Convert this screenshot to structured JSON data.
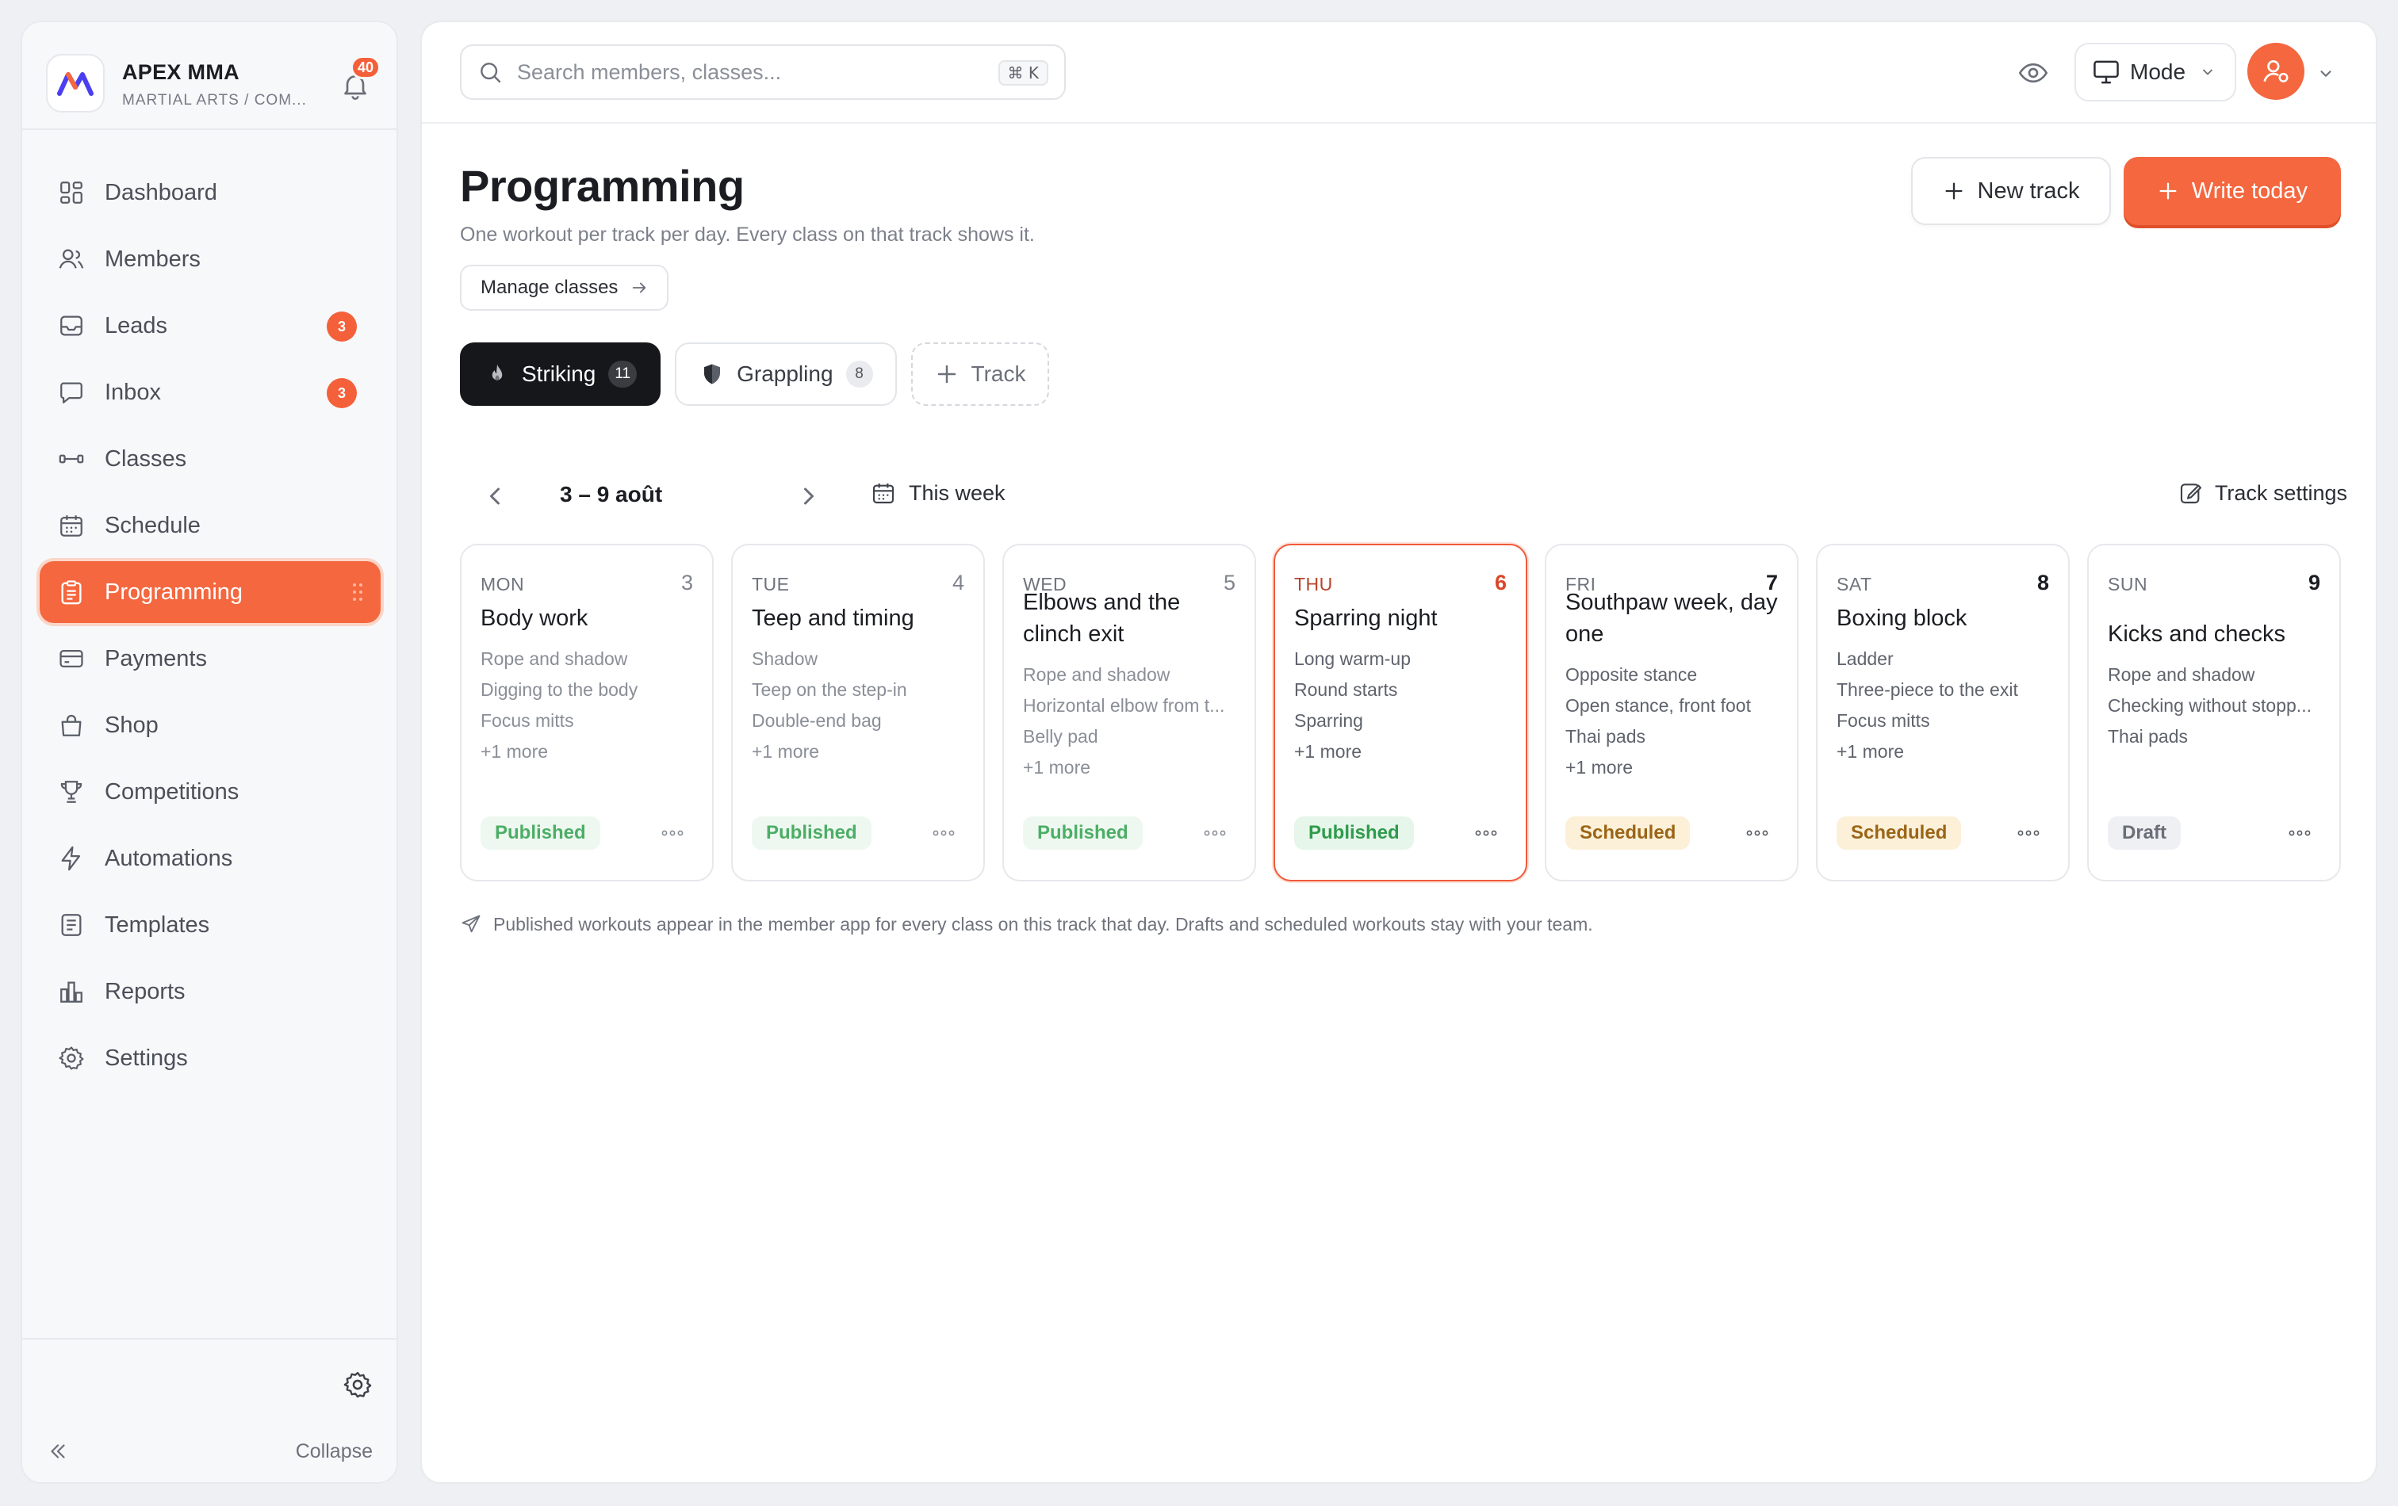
{
  "brand": {
    "name": "APEX MMA",
    "subtitle": "MARTIAL ARTS / COM...",
    "notifications": "40"
  },
  "nav": {
    "items": [
      {
        "label": "Dashboard",
        "icon": "dashboard-icon"
      },
      {
        "label": "Members",
        "icon": "users-icon"
      },
      {
        "label": "Leads",
        "icon": "inbox-tray-icon",
        "badge": "3"
      },
      {
        "label": "Inbox",
        "icon": "chat-bubble-icon",
        "badge": "3"
      },
      {
        "label": "Classes",
        "icon": "dumbbell-icon"
      },
      {
        "label": "Schedule",
        "icon": "calendar-icon"
      },
      {
        "label": "Programming",
        "icon": "clipboard-icon",
        "active": true
      },
      {
        "label": "Payments",
        "icon": "credit-card-icon"
      },
      {
        "label": "Shop",
        "icon": "shopping-bag-icon"
      },
      {
        "label": "Competitions",
        "icon": "trophy-icon"
      },
      {
        "label": "Automations",
        "icon": "lightning-icon"
      },
      {
        "label": "Templates",
        "icon": "document-icon"
      },
      {
        "label": "Reports",
        "icon": "bar-chart-icon"
      },
      {
        "label": "Settings",
        "icon": "gear-icon"
      }
    ],
    "collapse_label": "Collapse"
  },
  "topbar": {
    "search_placeholder": "Search members, classes...",
    "shortcut": "⌘ K",
    "mode_label": "Mode"
  },
  "page": {
    "title": "Programming",
    "subtitle": "One workout per track per day. Every class on that track shows it.",
    "manage_classes": "Manage classes",
    "new_track": "New track",
    "write_today": "Write today"
  },
  "tracks": [
    {
      "label": "Striking",
      "count": "11",
      "icon": "flame-icon",
      "active": true
    },
    {
      "label": "Grappling",
      "count": "8",
      "icon": "shield-icon",
      "active": false
    }
  ],
  "add_track_label": "Track",
  "week": {
    "range": "3 – 9 août",
    "this_week": "This week",
    "track_settings": "Track settings"
  },
  "days": [
    {
      "dow": "MON",
      "num": "3",
      "title": "Body work",
      "lines": [
        "Rope and shadow",
        "Digging to the body",
        "Focus mitts"
      ],
      "more": "+1 more",
      "status": "Published"
    },
    {
      "dow": "TUE",
      "num": "4",
      "title": "Teep and timing",
      "lines": [
        "Shadow",
        "Teep on the step-in",
        "Double-end bag"
      ],
      "more": "+1 more",
      "status": "Published"
    },
    {
      "dow": "WED",
      "num": "5",
      "title": "Elbows and the clinch exit",
      "lines": [
        "Rope and shadow",
        "Horizontal elbow from t...",
        "Belly pad"
      ],
      "more": "+1 more",
      "status": "Published"
    },
    {
      "dow": "THU",
      "num": "6",
      "title": "Sparring night",
      "lines": [
        "Long warm-up",
        "Round starts",
        "Sparring"
      ],
      "more": "+1 more",
      "status": "Published"
    },
    {
      "dow": "FRI",
      "num": "7",
      "title": "Southpaw week, day one",
      "lines": [
        "Opposite stance",
        "Open stance, front foot",
        "Thai pads"
      ],
      "more": "+1 more",
      "status": "Scheduled"
    },
    {
      "dow": "SAT",
      "num": "8",
      "title": "Boxing block",
      "lines": [
        "Ladder",
        "Three-piece to the exit",
        "Focus mitts"
      ],
      "more": "+1 more",
      "status": "Scheduled"
    },
    {
      "dow": "SUN",
      "num": "9",
      "title": "Kicks and checks",
      "lines": [
        "Rope and shadow",
        "Checking without stopp...",
        "Thai pads"
      ],
      "more": "",
      "status": "Draft"
    }
  ],
  "footnote": "Published workouts appear in the member app for every class on this track that day. Drafts and scheduled workouts stay with your team.",
  "colors": {
    "accent": "#f4673f",
    "published": "#2f9b4c",
    "scheduled": "#9b6516",
    "draft": "#6a6e78"
  }
}
